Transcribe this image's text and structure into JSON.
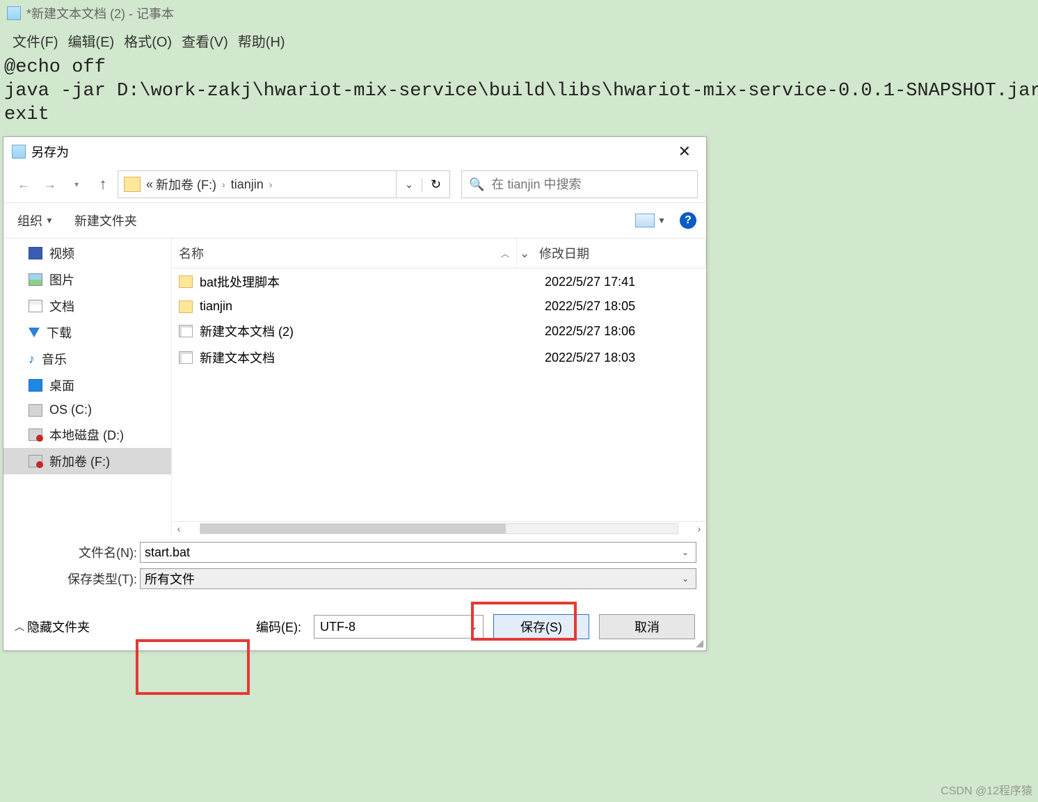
{
  "notepad": {
    "title": "*新建文本文档 (2) - 记事本",
    "menu": {
      "file": "文件(F)",
      "edit": "编辑(E)",
      "format": "格式(O)",
      "view": "查看(V)",
      "help": "帮助(H)"
    },
    "content": "@echo off\njava -jar D:\\work-zakj\\hwariot-mix-service\\build\\libs\\hwariot-mix-service-0.0.1-SNAPSHOT.jar\nexit"
  },
  "dialog": {
    "title": "另存为",
    "breadcrumbs": {
      "pre": "«",
      "a": "新加卷 (F:)",
      "b": "tianjin"
    },
    "search_placeholder": "在 tianjin 中搜索",
    "toolbar": {
      "organize": "组织",
      "newfolder": "新建文件夹"
    },
    "columns": {
      "name": "名称",
      "date": "修改日期"
    },
    "sidebar": [
      {
        "id": "video",
        "label": "视频"
      },
      {
        "id": "image",
        "label": "图片"
      },
      {
        "id": "doc",
        "label": "文档"
      },
      {
        "id": "download",
        "label": "下载"
      },
      {
        "id": "music",
        "label": "音乐"
      },
      {
        "id": "desktop",
        "label": "桌面"
      },
      {
        "id": "c",
        "label": "OS (C:)"
      },
      {
        "id": "d",
        "label": "本地磁盘 (D:)"
      },
      {
        "id": "f",
        "label": "新加卷 (F:)"
      }
    ],
    "files": [
      {
        "type": "folder",
        "name": "bat批处理脚本",
        "date": "2022/5/27 17:41"
      },
      {
        "type": "folder",
        "name": "tianjin",
        "date": "2022/5/27 18:05"
      },
      {
        "type": "file",
        "name": "新建文本文档 (2)",
        "date": "2022/5/27 18:06"
      },
      {
        "type": "file",
        "name": "新建文本文档",
        "date": "2022/5/27 18:03"
      }
    ],
    "form": {
      "filename_label": "文件名(N):",
      "filename_value": "start.bat",
      "filetype_label": "保存类型(T):",
      "filetype_value": "所有文件"
    },
    "footer": {
      "hide": "隐藏文件夹",
      "enc_label": "编码(E):",
      "enc_value": "UTF-8",
      "save": "保存(S)",
      "cancel": "取消"
    }
  },
  "watermark": "CSDN @12程序猿"
}
